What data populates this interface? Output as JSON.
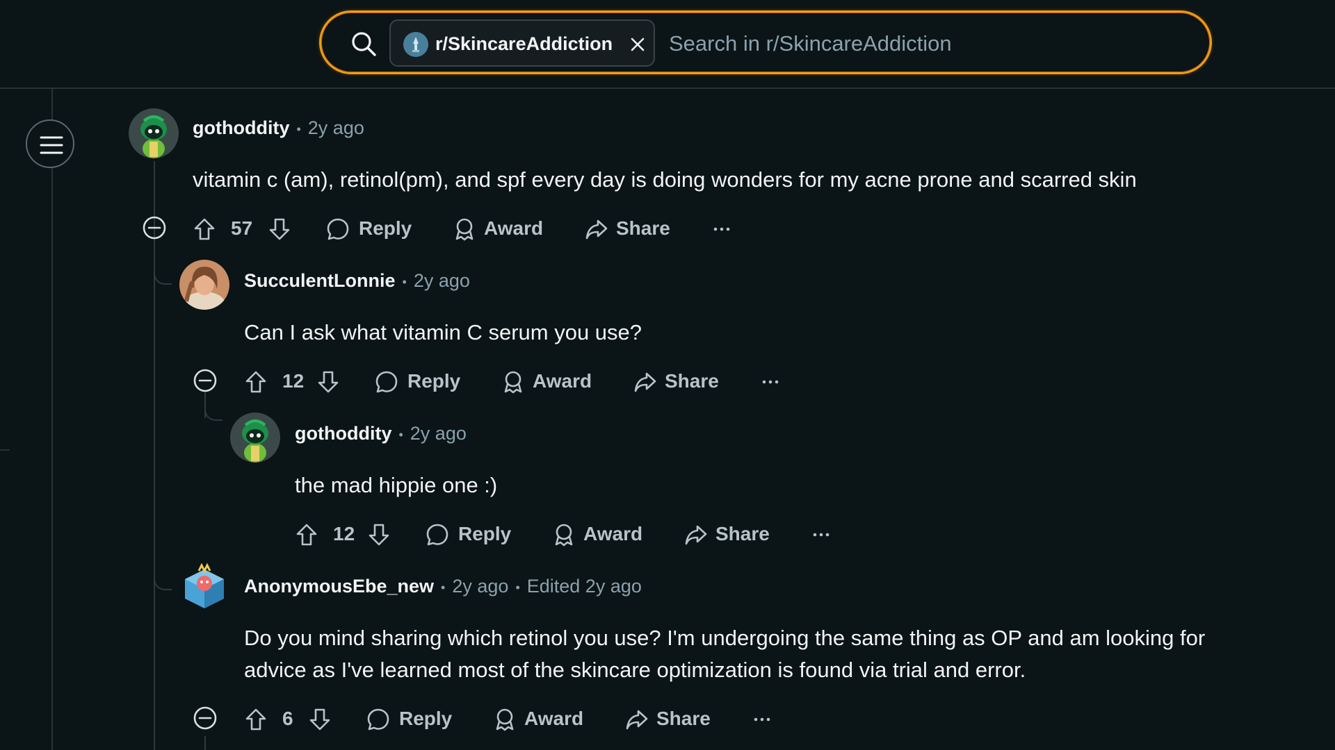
{
  "search": {
    "community_chip": "r/SkincareAddiction",
    "placeholder": "Search in r/SkincareAddiction"
  },
  "comments": [
    {
      "username": "gothoddity",
      "time": "2y ago",
      "body": "vitamin c (am), retinol(pm), and spf every day is doing wonders for my acne prone and scarred skin",
      "votes": "57",
      "reply_label": "Reply",
      "award_label": "Award",
      "share_label": "Share",
      "more_label": "···"
    },
    {
      "username": "SucculentLonnie",
      "time": "2y ago",
      "body": "Can I ask what vitamin C serum you use?",
      "votes": "12",
      "reply_label": "Reply",
      "award_label": "Award",
      "share_label": "Share",
      "more_label": "···"
    },
    {
      "username": "gothoddity",
      "time": "2y ago",
      "body": "the mad hippie one :)",
      "votes": "12",
      "reply_label": "Reply",
      "award_label": "Award",
      "share_label": "Share",
      "more_label": "···"
    },
    {
      "username": "AnonymousEbe_new",
      "time": "2y ago",
      "edited": "Edited 2y ago",
      "body_line1": "Do you mind sharing which retinol you use? I'm undergoing the same thing as OP and am looking for",
      "body_line2": "advice as I've learned most of the skincare optimization is found via trial and error.",
      "votes": "6",
      "reply_label": "Reply",
      "award_label": "Award",
      "share_label": "Share",
      "more_label": "···"
    }
  ],
  "colors": {
    "background": "#0b1416",
    "search_border_start": "#d9541e",
    "search_border_end": "#e8a010",
    "muted_text": "#8ba2ad",
    "action_text": "#b7c4ca"
  },
  "icons": [
    "search-icon",
    "close-icon",
    "menu-icon",
    "collapse-icon",
    "upvote-icon",
    "downvote-icon",
    "comment-icon",
    "award-icon",
    "share-icon",
    "more-icon"
  ]
}
